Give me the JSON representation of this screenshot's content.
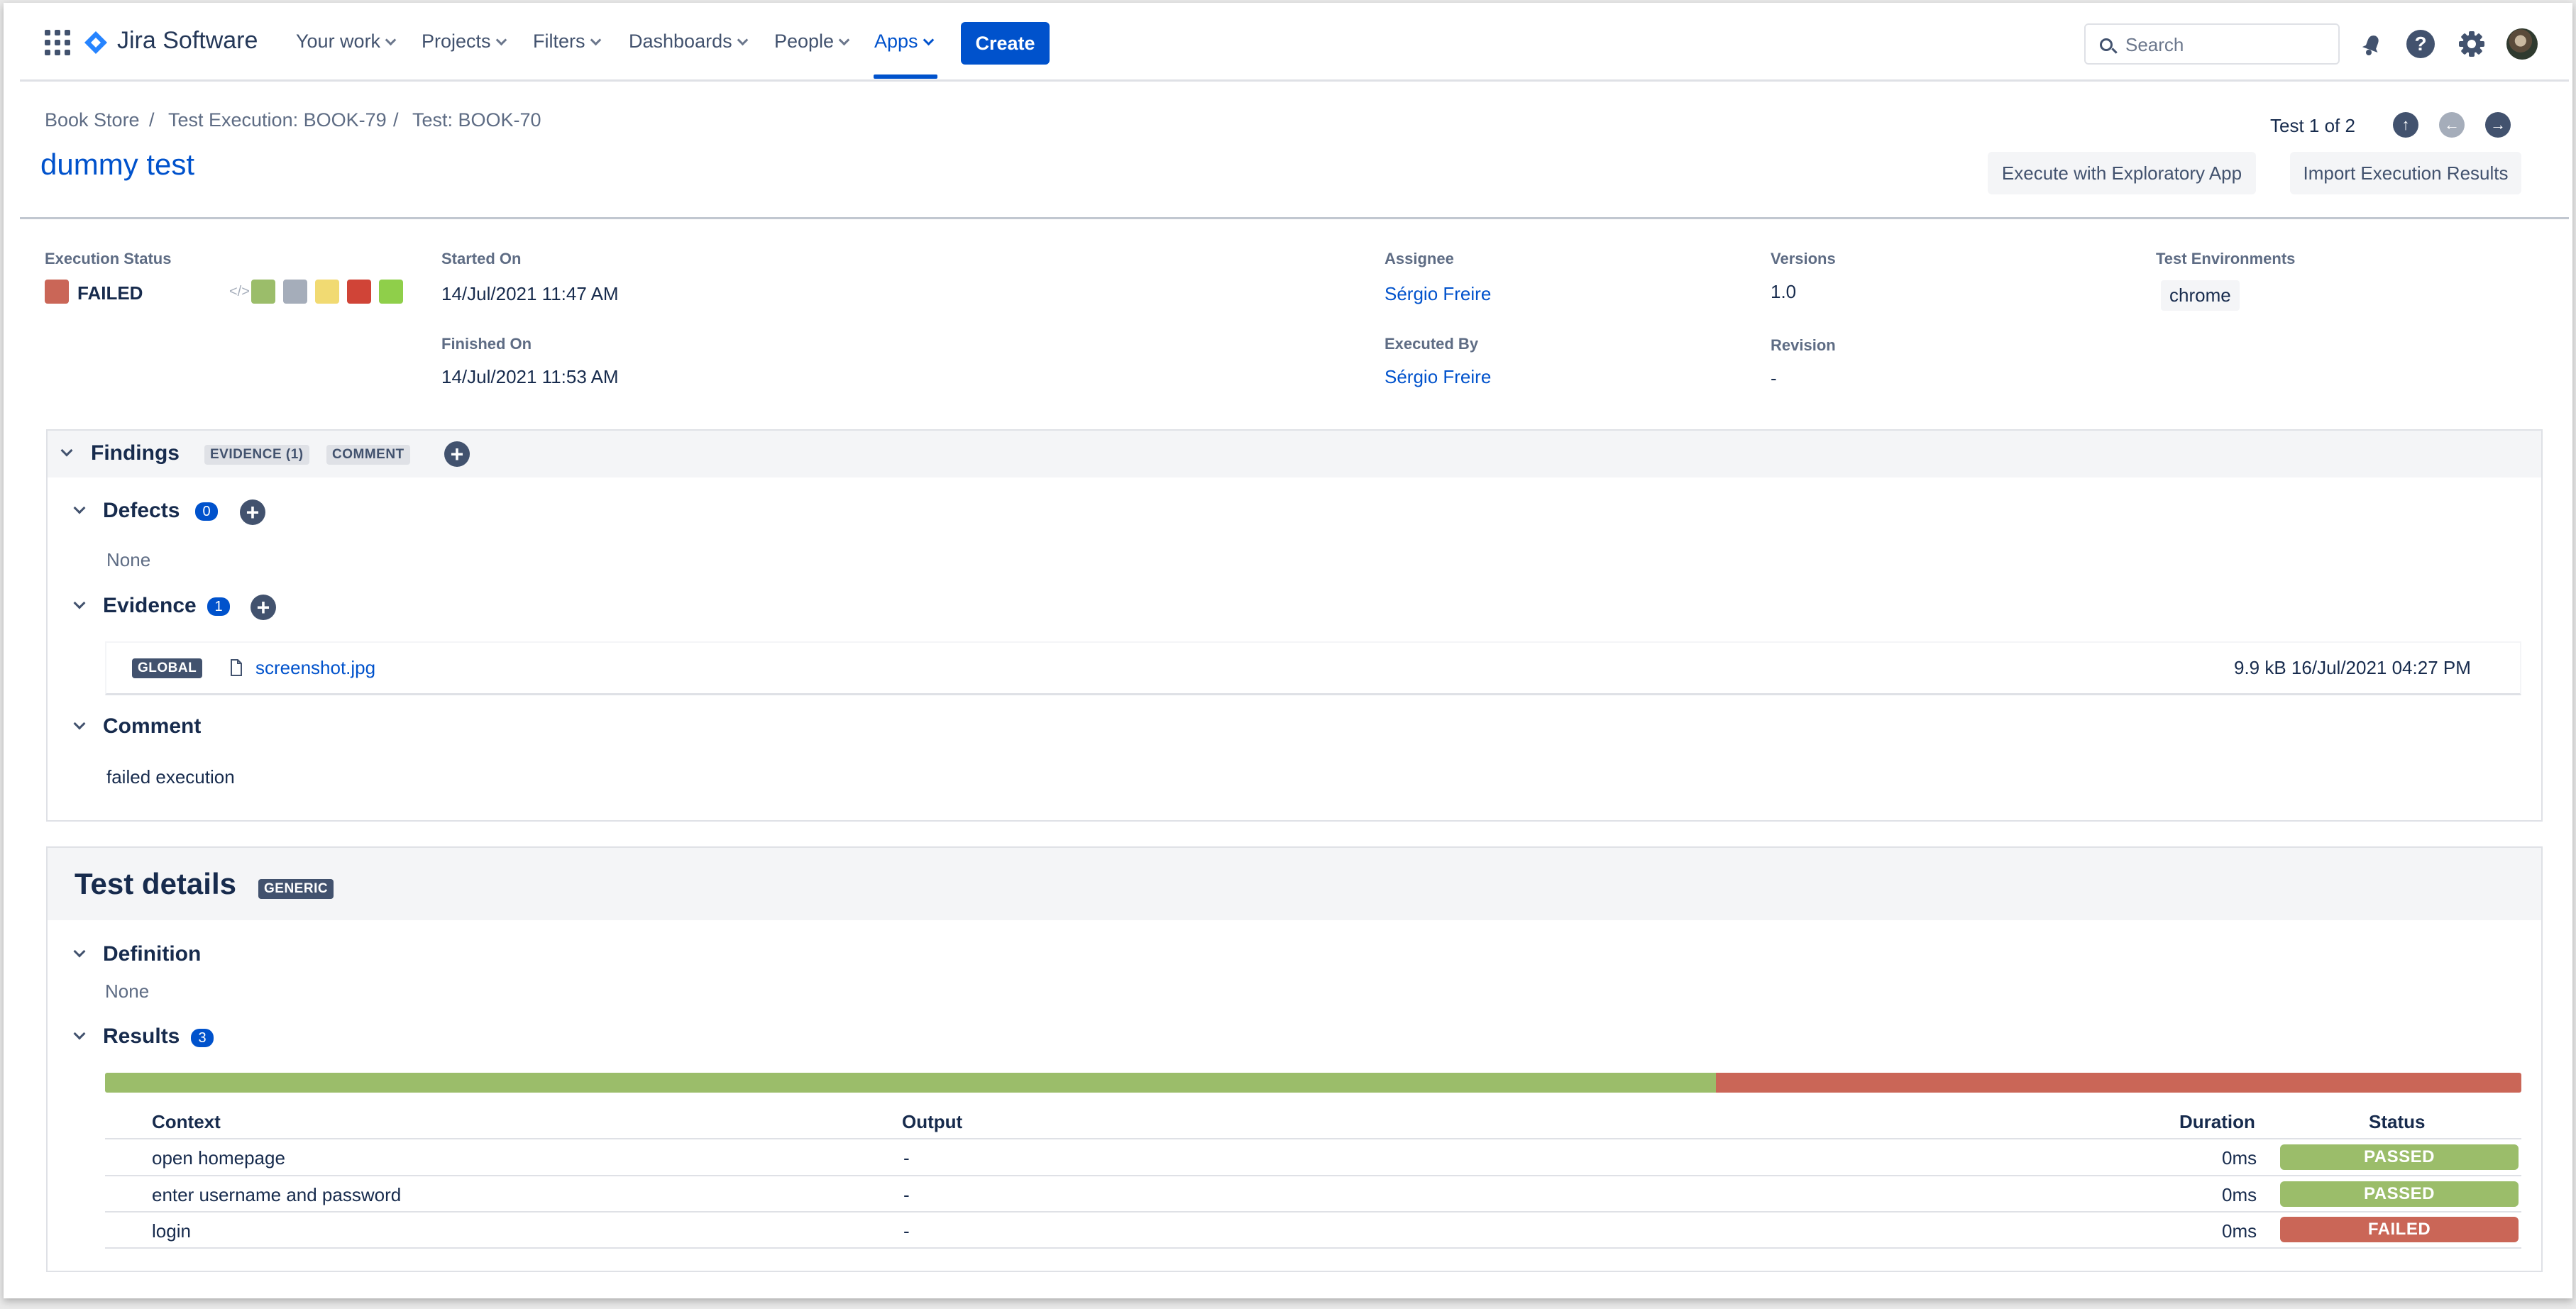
{
  "nav": {
    "logo": "Jira Software",
    "items": [
      "Your work",
      "Projects",
      "Filters",
      "Dashboards",
      "People",
      "Apps"
    ],
    "create": "Create",
    "search_placeholder": "Search"
  },
  "breadcrumb": [
    "Book Store",
    "Test Execution: BOOK-79",
    "Test: BOOK-70"
  ],
  "breadcrumb_sep": "/",
  "page_title": "dummy test",
  "pager": {
    "text": "Test 1 of 2"
  },
  "actions": {
    "exploratory": "Execute with Exploratory App",
    "import": "Import Execution Results"
  },
  "execution": {
    "status_label": "Execution Status",
    "status": "FAILED",
    "status_color": "#ca6657",
    "status_swatches": [
      "#9bbd6a",
      "#a5adba",
      "#f1da72",
      "#d04437",
      "#8fcf4a"
    ],
    "started_label": "Started On",
    "started": "14/Jul/2021 11:47 AM",
    "finished_label": "Finished On",
    "finished": "14/Jul/2021 11:53 AM",
    "assignee_label": "Assignee",
    "assignee": "Sérgio Freire",
    "executed_by_label": "Executed By",
    "executed_by": "Sérgio Freire",
    "versions_label": "Versions",
    "versions": "1.0",
    "revision_label": "Revision",
    "revision": "-",
    "env_label": "Test Environments",
    "env": "chrome"
  },
  "findings": {
    "title": "Findings",
    "tag_evidence": "EVIDENCE (1)",
    "tag_comment": "COMMENT",
    "defects_title": "Defects",
    "defects_count": "0",
    "defects_none": "None",
    "evidence_title": "Evidence",
    "evidence_count": "1",
    "evidence_item": {
      "scope": "GLOBAL",
      "file": "screenshot.jpg",
      "meta": "9.9 kB 16/Jul/2021 04:27 PM"
    },
    "comment_title": "Comment",
    "comment_text": "failed execution"
  },
  "details": {
    "title": "Test details",
    "type": "GENERIC",
    "definition_title": "Definition",
    "definition_none": "None",
    "results_title": "Results",
    "results_count": "3",
    "progress": {
      "passed": 2,
      "failed": 1
    },
    "colors": {
      "passed": "#9bbd6a",
      "failed": "#ca6657"
    },
    "headers": {
      "context": "Context",
      "output": "Output",
      "duration": "Duration",
      "status": "Status"
    },
    "rows": [
      {
        "context": "open homepage",
        "output": "-",
        "duration": "0ms",
        "status": "PASSED"
      },
      {
        "context": "enter username and password",
        "output": "-",
        "duration": "0ms",
        "status": "PASSED"
      },
      {
        "context": "login",
        "output": "-",
        "duration": "0ms",
        "status": "FAILED"
      }
    ]
  }
}
